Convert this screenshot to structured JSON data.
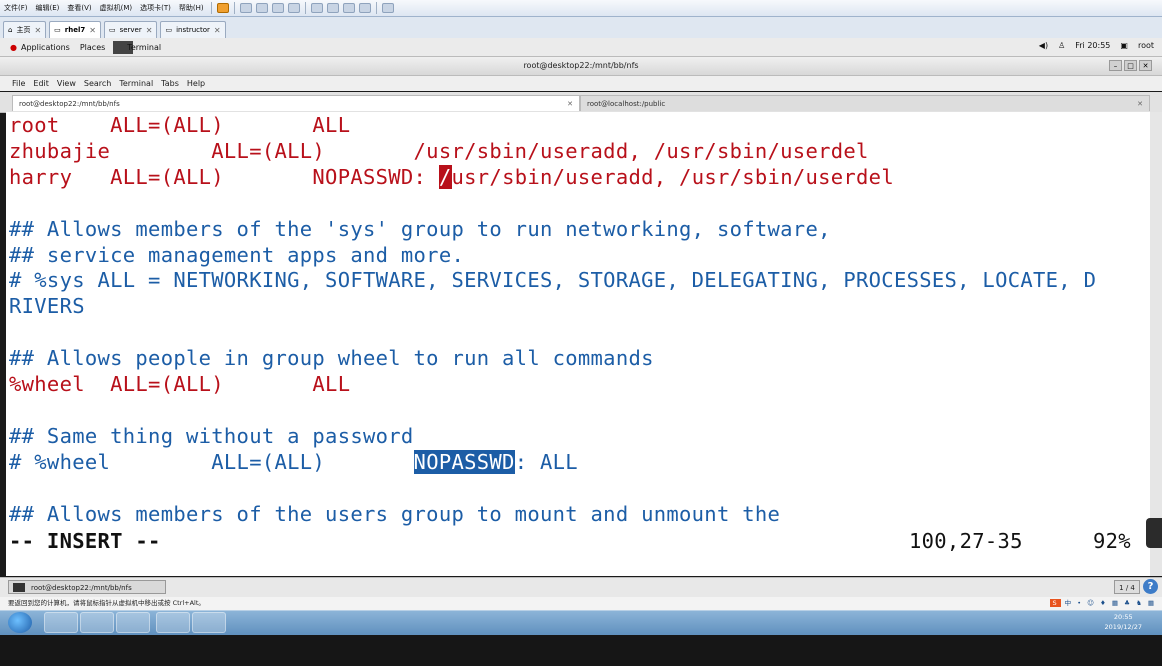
{
  "host": {
    "menus": [
      "文件(F)",
      "编辑(E)",
      "查看(V)",
      "虚拟机(M)",
      "选项卡(T)",
      "帮助(H)"
    ],
    "tabs": [
      {
        "label": "主页",
        "active": false
      },
      {
        "label": "rhel7",
        "active": true
      },
      {
        "label": "server",
        "active": false
      },
      {
        "label": "instructor",
        "active": false
      }
    ]
  },
  "gnome": {
    "applications": "Applications",
    "places": "Places",
    "terminal": "Terminal",
    "clock": "Fri 20:55",
    "user": "root"
  },
  "window": {
    "title": "root@desktop22:/mnt/bb/nfs",
    "menu": [
      "File",
      "Edit",
      "View",
      "Search",
      "Terminal",
      "Tabs",
      "Help"
    ],
    "tabs": [
      "root@desktop22:/mnt/bb/nfs",
      "root@localhost:/public"
    ]
  },
  "editor": {
    "lines": [
      [
        {
          "t": "root    ALL=(ALL)       ALL",
          "c": "red"
        }
      ],
      [
        {
          "t": "zhubajie        ALL=(ALL)       /usr/sbin/useradd, /usr/sbin/userdel",
          "c": "red"
        }
      ],
      [
        {
          "t": "harry   ALL=(ALL)       NOPASSWD: ",
          "c": "red"
        },
        {
          "t": "/",
          "c": "cursor"
        },
        {
          "t": "usr/sbin/useradd, /usr/sbin/userdel",
          "c": "red"
        }
      ],
      [],
      [
        {
          "t": "## Allows members of the 'sys' group to run networking, software,",
          "c": "blue"
        }
      ],
      [
        {
          "t": "## service management apps and more.",
          "c": "blue"
        }
      ],
      [
        {
          "t": "# %sys ALL = NETWORKING, SOFTWARE, SERVICES, STORAGE, DELEGATING, PROCESSES, LOCATE, D",
          "c": "blue"
        }
      ],
      [
        {
          "t": "RIVERS",
          "c": "blue"
        }
      ],
      [],
      [
        {
          "t": "## Allows people in group wheel to run all commands",
          "c": "blue"
        }
      ],
      [
        {
          "t": "%wheel  ALL=(ALL)       ALL",
          "c": "red"
        }
      ],
      [],
      [
        {
          "t": "## Same thing without a password",
          "c": "blue"
        }
      ],
      [
        {
          "t": "# %wheel        ALL=(ALL)       ",
          "c": "blue"
        },
        {
          "t": "NOPASSWD",
          "c": "hl"
        },
        {
          "t": ": ALL",
          "c": "blue"
        }
      ],
      [],
      [
        {
          "t": "## Allows members of the users group to mount and unmount the",
          "c": "blue"
        }
      ]
    ],
    "mode": "-- INSERT --",
    "position": "100,27-35",
    "percent": "92%"
  },
  "bottom": {
    "task": "root@desktop22:/mnt/bb/nfs",
    "workspace": "1 / 4",
    "hint": "要返回到您的计算机，请将鼠标指针从虚拟机中移出或按 Ctrl+Alt。"
  },
  "taskbar": {
    "time": "20:55",
    "date": "2019/12/27"
  }
}
